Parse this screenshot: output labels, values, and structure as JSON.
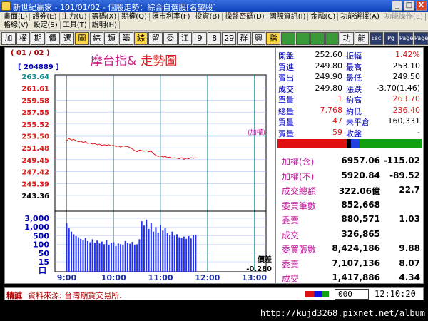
{
  "window": {
    "app_name": "新世紀贏家",
    "title": "新世紀贏家 - 101/01/02 - 個股走勢：綜合自選股[名望股]",
    "buttons": [
      "_",
      "□",
      "X"
    ]
  },
  "menu": {
    "row1": [
      "畫面(L)",
      "證券(E)",
      "主力(U)",
      "籌碼(X)",
      "期權(Q)",
      "匯市利率(F)",
      "投資(B)",
      "操盤密碼(D)",
      "國際資訊(I)",
      "金融(C)",
      "功能選擇(A)"
    ],
    "row1_dim": [
      "功能操作(E)"
    ],
    "row2": [
      "格線(V)",
      "設定(S)",
      "工具(T)",
      "說明(H)"
    ]
  },
  "toolbar": {
    "buttons": [
      "加",
      "權",
      "期",
      "價",
      "選",
      "圖",
      "綜",
      "類",
      "籌",
      "綜",
      "留",
      "委",
      "江",
      "9",
      "8",
      "29",
      "群",
      "興",
      "指",
      "",
      "",
      "",
      "",
      "功",
      "能",
      "Esc",
      "Pg",
      "Page",
      "Page"
    ]
  },
  "chart": {
    "date": "( 01 / 02 )",
    "volume_tag": "[ 204889 ]",
    "title_part1": "摩台指&",
    "title_part2": "走勢圖",
    "ref_label": "(加權)",
    "diff_label": "價差",
    "diff_value": "-0.280",
    "vol_axis_unit": "口"
  },
  "chart_data": {
    "type": "line",
    "y_ticks": [
      "263.64",
      "261.61",
      "259.58",
      "257.55",
      "255.52",
      "253.50",
      "251.48",
      "249.45",
      "247.42",
      "245.39",
      "243.36"
    ],
    "ylim": [
      243.36,
      263.64
    ],
    "reference": 253.5,
    "x_ticks": [
      "9:00",
      "10:00",
      "11:00",
      "12:00",
      "13:00"
    ],
    "vol_ticks": [
      "3,000",
      "1,000",
      "500",
      "100",
      "50",
      "15"
    ],
    "series": [
      {
        "name": "price",
        "x": [
          0,
          3,
          6,
          9,
          12,
          15,
          18,
          21,
          24,
          27,
          30,
          33,
          36,
          39,
          42,
          45,
          48,
          51,
          54,
          57,
          60,
          63,
          66,
          69,
          72,
          75,
          78,
          81,
          84,
          87,
          90,
          93,
          96,
          99,
          102,
          105,
          108,
          111,
          114,
          117,
          120,
          123,
          126,
          129,
          132,
          135,
          138,
          141,
          144,
          147,
          150,
          153,
          156,
          159,
          162,
          165
        ],
        "values": [
          252.6,
          253.1,
          252.8,
          252.9,
          252.7,
          252.5,
          252.6,
          252.4,
          252.5,
          252.2,
          252.3,
          252.1,
          252.2,
          252.0,
          252.1,
          251.9,
          252.0,
          251.9,
          252.0,
          251.8,
          251.9,
          251.7,
          251.8,
          251.6,
          251.8,
          251.7,
          251.7,
          251.5,
          251.3,
          251.0,
          250.8,
          251.1,
          251.0,
          250.9,
          251.0,
          250.8,
          250.9,
          250.5,
          250.2,
          250.0,
          250.1,
          249.9,
          250.0,
          249.8,
          249.9,
          249.7,
          249.8,
          249.7,
          249.6,
          249.8,
          249.5,
          249.7,
          249.6,
          249.8,
          249.7,
          249.8
        ]
      }
    ],
    "volumes": [
      820,
      410,
      260,
      180,
      140,
      120,
      95,
      80,
      110,
      70,
      60,
      90,
      55,
      75,
      50,
      65,
      45,
      80,
      40,
      55,
      60,
      35,
      50,
      45,
      40,
      70,
      55,
      48,
      62,
      38,
      44,
      90,
      1100,
      600,
      1400,
      380,
      900,
      260,
      480,
      220,
      650,
      300,
      420,
      210,
      160,
      260,
      150,
      180,
      120,
      110,
      130,
      95,
      140,
      100,
      160,
      170
    ]
  },
  "quote": {
    "rows": [
      {
        "l1": "開盤",
        "v1": "252.60",
        "c1": "black",
        "l2": "振幅",
        "v2": "1.42%",
        "c2": "red"
      },
      {
        "l1": "買進",
        "v1": "249.80",
        "c1": "black",
        "l2": "最高",
        "v2": "253.10",
        "c2": "black"
      },
      {
        "l1": "賣出",
        "v1": "249.90",
        "c1": "black",
        "l2": "最低",
        "v2": "249.50",
        "c2": "black"
      },
      {
        "l1": "成交",
        "v1": "249.80",
        "c1": "black",
        "l2": "漲跌",
        "v2": "-3.70(1.46)",
        "c2": "black"
      },
      {
        "l1": "單量",
        "v1": "1",
        "c1": "red",
        "l2": "約高",
        "v2": "263.70",
        "c2": "red"
      },
      {
        "l1": "總量",
        "v1": "7,768",
        "c1": "red",
        "l2": "約低",
        "v2": "236.40",
        "c2": "red"
      },
      {
        "l1": "買量",
        "v1": "47",
        "c1": "red",
        "l2": "未平倉",
        "v2": "160,331",
        "c2": "black"
      },
      {
        "l1": "賣量",
        "v1": "59",
        "c1": "red",
        "l2": "收盤",
        "v2": "-",
        "c2": "black"
      }
    ]
  },
  "index": {
    "rows": [
      {
        "label": "加權(含)",
        "value": "6957.06",
        "change": "-115.02"
      },
      {
        "label": "加權(不)",
        "value": "5920.84",
        "change": "-89.52"
      },
      {
        "label": "成交總額",
        "value": "322.06億",
        "change": "22.7"
      },
      {
        "label": "委買筆數",
        "value": "852,668",
        "change": ""
      },
      {
        "label": "委賣",
        "value": "880,571",
        "change": "1.03"
      },
      {
        "label": "成交",
        "value": "326,865",
        "change": ""
      },
      {
        "label": "委買張數",
        "value": "8,424,186",
        "change": "9.88"
      },
      {
        "label": "委賣",
        "value": "7,107,136",
        "change": "8.07"
      },
      {
        "label": "成交",
        "value": "1,417,886",
        "change": "4.34"
      }
    ]
  },
  "status": {
    "tag": "精誠",
    "source": "資料來源: 台灣期貨交易所.",
    "code_value": "000",
    "clock": "12:10:20"
  },
  "footer": {
    "url": "http://kujd3268.pixnet.net/album"
  }
}
